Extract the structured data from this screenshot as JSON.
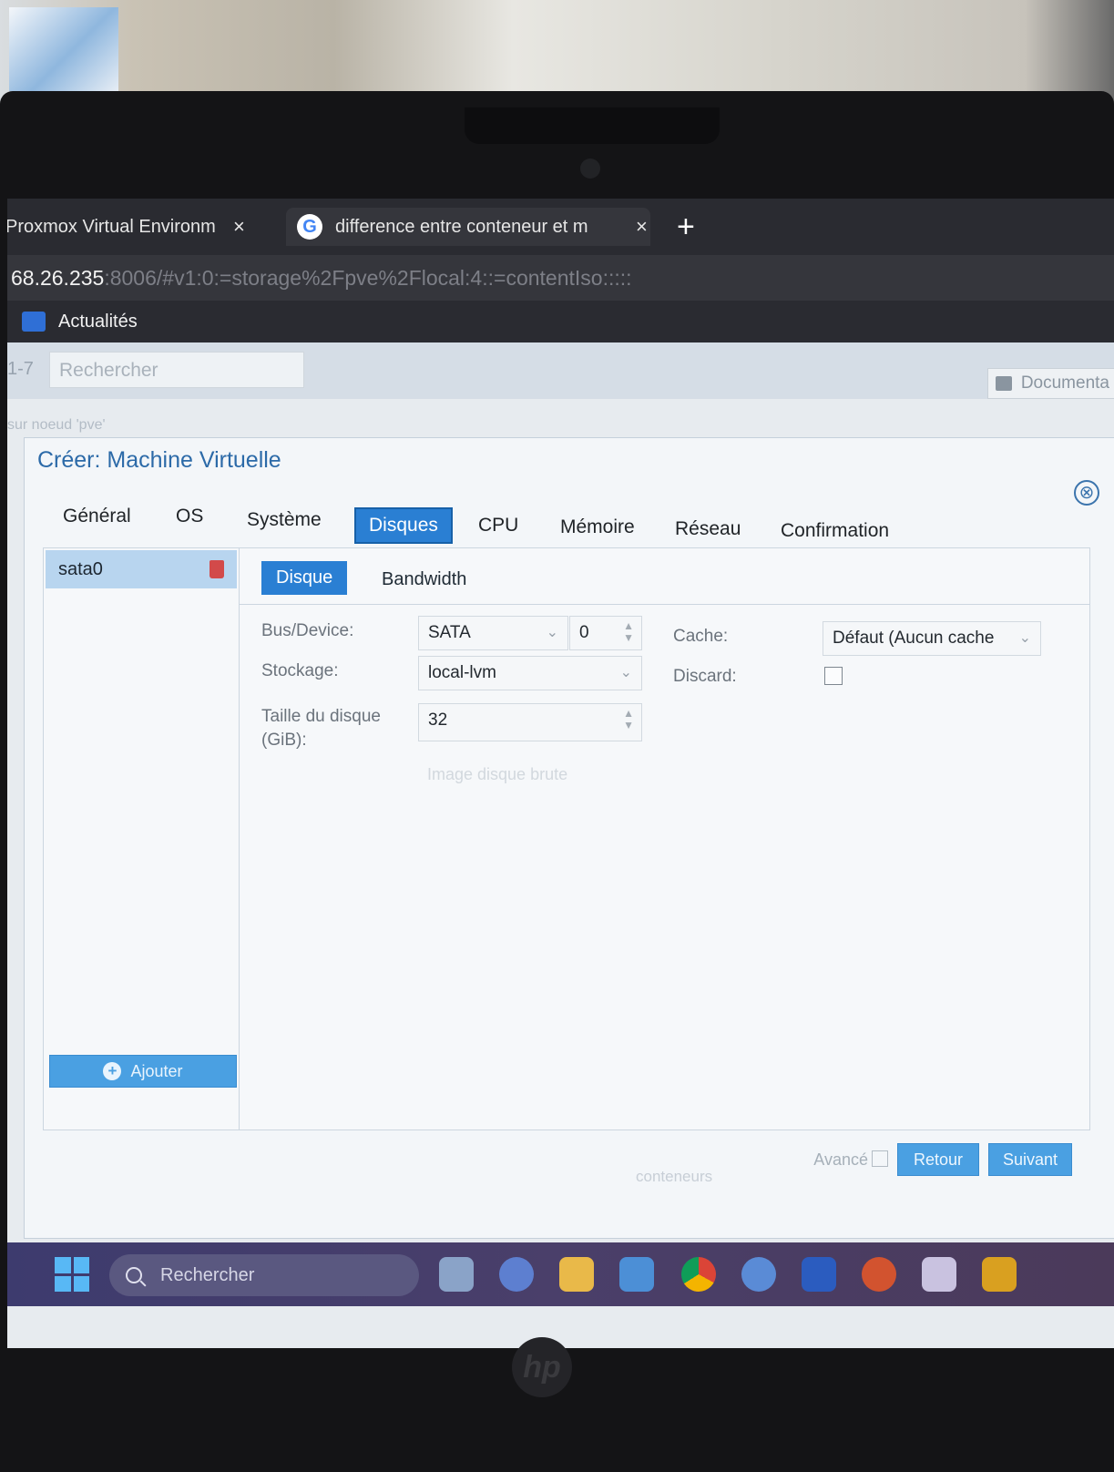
{
  "browser": {
    "tabs": [
      {
        "title": "Proxmox Virtual Environm",
        "close": "×"
      },
      {
        "title": "difference entre conteneur et m",
        "close": "×",
        "icon": "google-icon"
      }
    ],
    "new_tab": "+",
    "url_host": "68.26.235",
    "url_rest": ":8006/#v1:0:=storage%2Fpve%2Flocal:4::=contentIso:::::",
    "bookmark_label": "Actualités"
  },
  "pve": {
    "version": "1-7",
    "search_placeholder": "Rechercher",
    "documentation": "Documenta",
    "node_crumb": "sur noeud 'pve'"
  },
  "dialog": {
    "title": "Créer: Machine Virtuelle",
    "close": "⊗",
    "tabs": [
      "Général",
      "OS",
      "Système",
      "Disques",
      "CPU",
      "Mémoire",
      "Réseau",
      "Confirmation"
    ],
    "active_tab": "Disques",
    "disk_list": {
      "items": [
        {
          "label": "sata0"
        }
      ],
      "add_label": "Ajouter"
    },
    "subtabs": [
      "Disque",
      "Bandwidth"
    ],
    "form": {
      "bus_label": "Bus/Device:",
      "bus_value": "SATA",
      "device_value": "0",
      "storage_label": "Stockage:",
      "storage_value": "local-lvm",
      "size_label_1": "Taille du disque",
      "size_label_2": "(GiB):",
      "size_value": "32",
      "format_hint": "Image disque brute",
      "cache_label": "Cache:",
      "cache_value": "Défaut (Aucun cache",
      "discard_label": "Discard:"
    },
    "footer": {
      "advanced_label": "Avancé",
      "back_label": "Retour",
      "next_label": "Suivant"
    }
  },
  "background_text": "conteneurs",
  "taskbar": {
    "search_placeholder": "Rechercher",
    "apps": [
      "widgets-icon",
      "chat-icon",
      "file-explorer-icon",
      "store-icon",
      "chrome-icon",
      "settings-icon",
      "word-icon",
      "powerpoint-icon",
      "snipping-icon",
      "filezilla-icon"
    ]
  },
  "colors": {
    "accent": "#2a7fd3",
    "title_blue": "#2c6aa8",
    "delete_red": "#d24a4a"
  }
}
